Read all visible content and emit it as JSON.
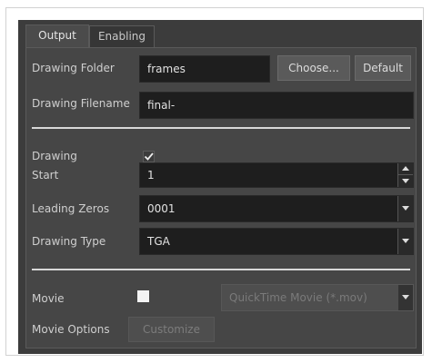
{
  "tabs": [
    {
      "label": "Output",
      "active": true
    },
    {
      "label": "Enabling",
      "active": false
    }
  ],
  "output": {
    "drawing_folder_label": "Drawing Folder",
    "drawing_folder_value": "frames",
    "choose_button": "Choose...",
    "default_button": "Default",
    "drawing_filename_label": "Drawing Filename",
    "drawing_filename_value": "final-",
    "drawing_label": "Drawing",
    "drawing_checked": true,
    "start_label": "Start",
    "start_value": "1",
    "leading_zeros_label": "Leading Zeros",
    "leading_zeros_value": "0001",
    "drawing_type_label": "Drawing Type",
    "drawing_type_value": "TGA",
    "movie_label": "Movie",
    "movie_checked": false,
    "movie_format_value": "QuickTime Movie (*.mov)",
    "movie_options_label": "Movie Options",
    "customize_button": "Customize"
  },
  "colors": {
    "dialog_bg": "#3c3c3c",
    "panel_bg": "#464646",
    "field_bg": "#1e1e1e",
    "separator": "#d8d8d8"
  }
}
